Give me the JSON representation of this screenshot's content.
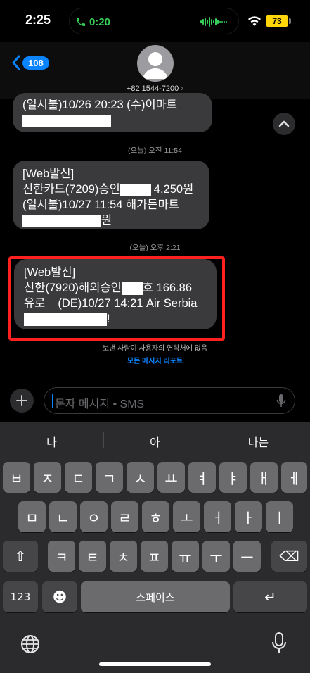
{
  "status_bar": {
    "time": "2:25",
    "call_duration": "0:20",
    "battery": "73"
  },
  "header": {
    "back_badge": "108",
    "contact": "+82 1544-7200",
    "chevron": "›"
  },
  "messages": [
    {
      "lines": [
        "(일시불)10/26 20:23 (수)이마트"
      ]
    },
    {
      "timestamp": "(오늘) 오전 11:54",
      "lines": [
        "[Web발신]",
        "신한카드(7209)승인",
        "4,250원",
        "(일시불)10/27 11:54 해가든마트",
        "원"
      ]
    },
    {
      "timestamp": "(오늘) 오후 2:21",
      "lines": [
        "[Web발신]",
        "신한(7920)해외승인",
        "호 166.86",
        "유로",
        "(DE)10/27 14:21 Air Serbia",
        "!"
      ]
    }
  ],
  "notice": "보낸 사람이 사용자의 연락처에 없음",
  "report_link": "모든 메시지 리포트",
  "input": {
    "placeholder": "문자 메시지 • SMS"
  },
  "keyboard": {
    "suggestions": [
      "나",
      "아",
      "나는"
    ],
    "row1": [
      "ㅂ",
      "ㅈ",
      "ㄷ",
      "ㄱ",
      "ㅅ",
      "ㅛ",
      "ㅕ",
      "ㅑ",
      "ㅐ",
      "ㅔ"
    ],
    "row2": [
      "ㅁ",
      "ㄴ",
      "ㅇ",
      "ㄹ",
      "ㅎ",
      "ㅗ",
      "ㅓ",
      "ㅏ",
      "ㅣ"
    ],
    "row3": [
      "ㅋ",
      "ㅌ",
      "ㅊ",
      "ㅍ",
      "ㅠ",
      "ㅜ",
      "ㅡ"
    ],
    "numbers_key": "123",
    "emoji_key": "☻",
    "space_key": "스페이스",
    "shift_glyph": "⇧",
    "delete_glyph": "⌫",
    "return_glyph": "↵"
  },
  "colors": {
    "accent": "#0a84ff",
    "call_green": "#35d05a",
    "battery_yellow": "#ffd60a",
    "highlight_red": "#ff2020"
  }
}
